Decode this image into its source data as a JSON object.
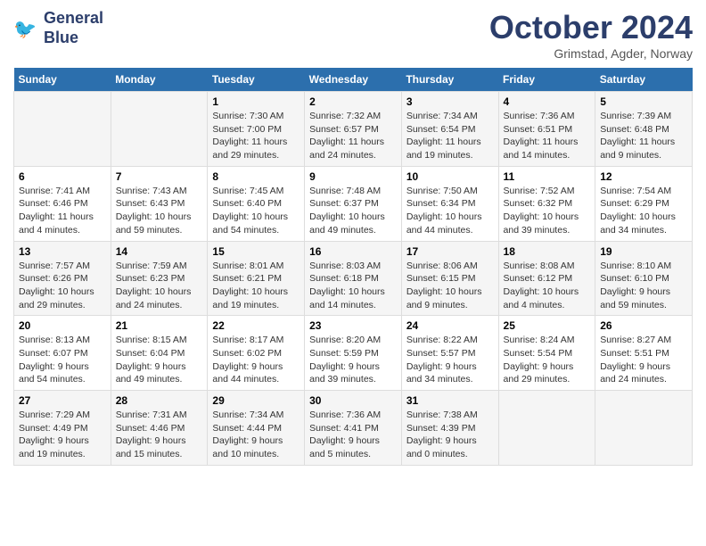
{
  "header": {
    "logo_line1": "General",
    "logo_line2": "Blue",
    "title": "October 2024",
    "subtitle": "Grimstad, Agder, Norway"
  },
  "weekdays": [
    "Sunday",
    "Monday",
    "Tuesday",
    "Wednesday",
    "Thursday",
    "Friday",
    "Saturday"
  ],
  "weeks": [
    [
      {
        "day": "",
        "text": ""
      },
      {
        "day": "",
        "text": ""
      },
      {
        "day": "1",
        "text": "Sunrise: 7:30 AM\nSunset: 7:00 PM\nDaylight: 11 hours and 29 minutes."
      },
      {
        "day": "2",
        "text": "Sunrise: 7:32 AM\nSunset: 6:57 PM\nDaylight: 11 hours and 24 minutes."
      },
      {
        "day": "3",
        "text": "Sunrise: 7:34 AM\nSunset: 6:54 PM\nDaylight: 11 hours and 19 minutes."
      },
      {
        "day": "4",
        "text": "Sunrise: 7:36 AM\nSunset: 6:51 PM\nDaylight: 11 hours and 14 minutes."
      },
      {
        "day": "5",
        "text": "Sunrise: 7:39 AM\nSunset: 6:48 PM\nDaylight: 11 hours and 9 minutes."
      }
    ],
    [
      {
        "day": "6",
        "text": "Sunrise: 7:41 AM\nSunset: 6:46 PM\nDaylight: 11 hours and 4 minutes."
      },
      {
        "day": "7",
        "text": "Sunrise: 7:43 AM\nSunset: 6:43 PM\nDaylight: 10 hours and 59 minutes."
      },
      {
        "day": "8",
        "text": "Sunrise: 7:45 AM\nSunset: 6:40 PM\nDaylight: 10 hours and 54 minutes."
      },
      {
        "day": "9",
        "text": "Sunrise: 7:48 AM\nSunset: 6:37 PM\nDaylight: 10 hours and 49 minutes."
      },
      {
        "day": "10",
        "text": "Sunrise: 7:50 AM\nSunset: 6:34 PM\nDaylight: 10 hours and 44 minutes."
      },
      {
        "day": "11",
        "text": "Sunrise: 7:52 AM\nSunset: 6:32 PM\nDaylight: 10 hours and 39 minutes."
      },
      {
        "day": "12",
        "text": "Sunrise: 7:54 AM\nSunset: 6:29 PM\nDaylight: 10 hours and 34 minutes."
      }
    ],
    [
      {
        "day": "13",
        "text": "Sunrise: 7:57 AM\nSunset: 6:26 PM\nDaylight: 10 hours and 29 minutes."
      },
      {
        "day": "14",
        "text": "Sunrise: 7:59 AM\nSunset: 6:23 PM\nDaylight: 10 hours and 24 minutes."
      },
      {
        "day": "15",
        "text": "Sunrise: 8:01 AM\nSunset: 6:21 PM\nDaylight: 10 hours and 19 minutes."
      },
      {
        "day": "16",
        "text": "Sunrise: 8:03 AM\nSunset: 6:18 PM\nDaylight: 10 hours and 14 minutes."
      },
      {
        "day": "17",
        "text": "Sunrise: 8:06 AM\nSunset: 6:15 PM\nDaylight: 10 hours and 9 minutes."
      },
      {
        "day": "18",
        "text": "Sunrise: 8:08 AM\nSunset: 6:12 PM\nDaylight: 10 hours and 4 minutes."
      },
      {
        "day": "19",
        "text": "Sunrise: 8:10 AM\nSunset: 6:10 PM\nDaylight: 9 hours and 59 minutes."
      }
    ],
    [
      {
        "day": "20",
        "text": "Sunrise: 8:13 AM\nSunset: 6:07 PM\nDaylight: 9 hours and 54 minutes."
      },
      {
        "day": "21",
        "text": "Sunrise: 8:15 AM\nSunset: 6:04 PM\nDaylight: 9 hours and 49 minutes."
      },
      {
        "day": "22",
        "text": "Sunrise: 8:17 AM\nSunset: 6:02 PM\nDaylight: 9 hours and 44 minutes."
      },
      {
        "day": "23",
        "text": "Sunrise: 8:20 AM\nSunset: 5:59 PM\nDaylight: 9 hours and 39 minutes."
      },
      {
        "day": "24",
        "text": "Sunrise: 8:22 AM\nSunset: 5:57 PM\nDaylight: 9 hours and 34 minutes."
      },
      {
        "day": "25",
        "text": "Sunrise: 8:24 AM\nSunset: 5:54 PM\nDaylight: 9 hours and 29 minutes."
      },
      {
        "day": "26",
        "text": "Sunrise: 8:27 AM\nSunset: 5:51 PM\nDaylight: 9 hours and 24 minutes."
      }
    ],
    [
      {
        "day": "27",
        "text": "Sunrise: 7:29 AM\nSunset: 4:49 PM\nDaylight: 9 hours and 19 minutes."
      },
      {
        "day": "28",
        "text": "Sunrise: 7:31 AM\nSunset: 4:46 PM\nDaylight: 9 hours and 15 minutes."
      },
      {
        "day": "29",
        "text": "Sunrise: 7:34 AM\nSunset: 4:44 PM\nDaylight: 9 hours and 10 minutes."
      },
      {
        "day": "30",
        "text": "Sunrise: 7:36 AM\nSunset: 4:41 PM\nDaylight: 9 hours and 5 minutes."
      },
      {
        "day": "31",
        "text": "Sunrise: 7:38 AM\nSunset: 4:39 PM\nDaylight: 9 hours and 0 minutes."
      },
      {
        "day": "",
        "text": ""
      },
      {
        "day": "",
        "text": ""
      }
    ]
  ]
}
